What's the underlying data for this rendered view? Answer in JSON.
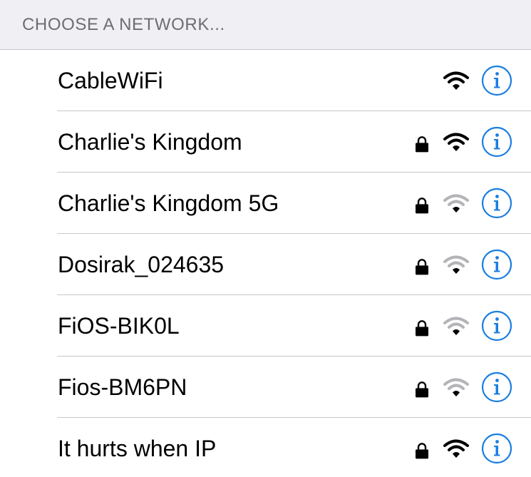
{
  "header": {
    "section_title": "CHOOSE A NETWORK..."
  },
  "colors": {
    "accent": "#1a7ee0",
    "header_bg": "#efeff4",
    "header_text": "#6d6d72",
    "separator": "#c8c7cc",
    "wifi_active": "#000000",
    "wifi_inactive": "#b4b4b8"
  },
  "networks": [
    {
      "name": "CableWiFi",
      "locked": false,
      "signal_bars": 3,
      "info_icon": "info-icon"
    },
    {
      "name": "Charlie's Kingdom",
      "locked": true,
      "signal_bars": 3,
      "info_icon": "info-icon"
    },
    {
      "name": "Charlie's Kingdom 5G",
      "locked": true,
      "signal_bars": 1,
      "info_icon": "info-icon"
    },
    {
      "name": "Dosirak_024635",
      "locked": true,
      "signal_bars": 1,
      "info_icon": "info-icon"
    },
    {
      "name": "FiOS-BIK0L",
      "locked": true,
      "signal_bars": 1,
      "info_icon": "info-icon"
    },
    {
      "name": "Fios-BM6PN",
      "locked": true,
      "signal_bars": 1,
      "info_icon": "info-icon"
    },
    {
      "name": "It hurts when IP",
      "locked": true,
      "signal_bars": 3,
      "info_icon": "info-icon"
    }
  ]
}
